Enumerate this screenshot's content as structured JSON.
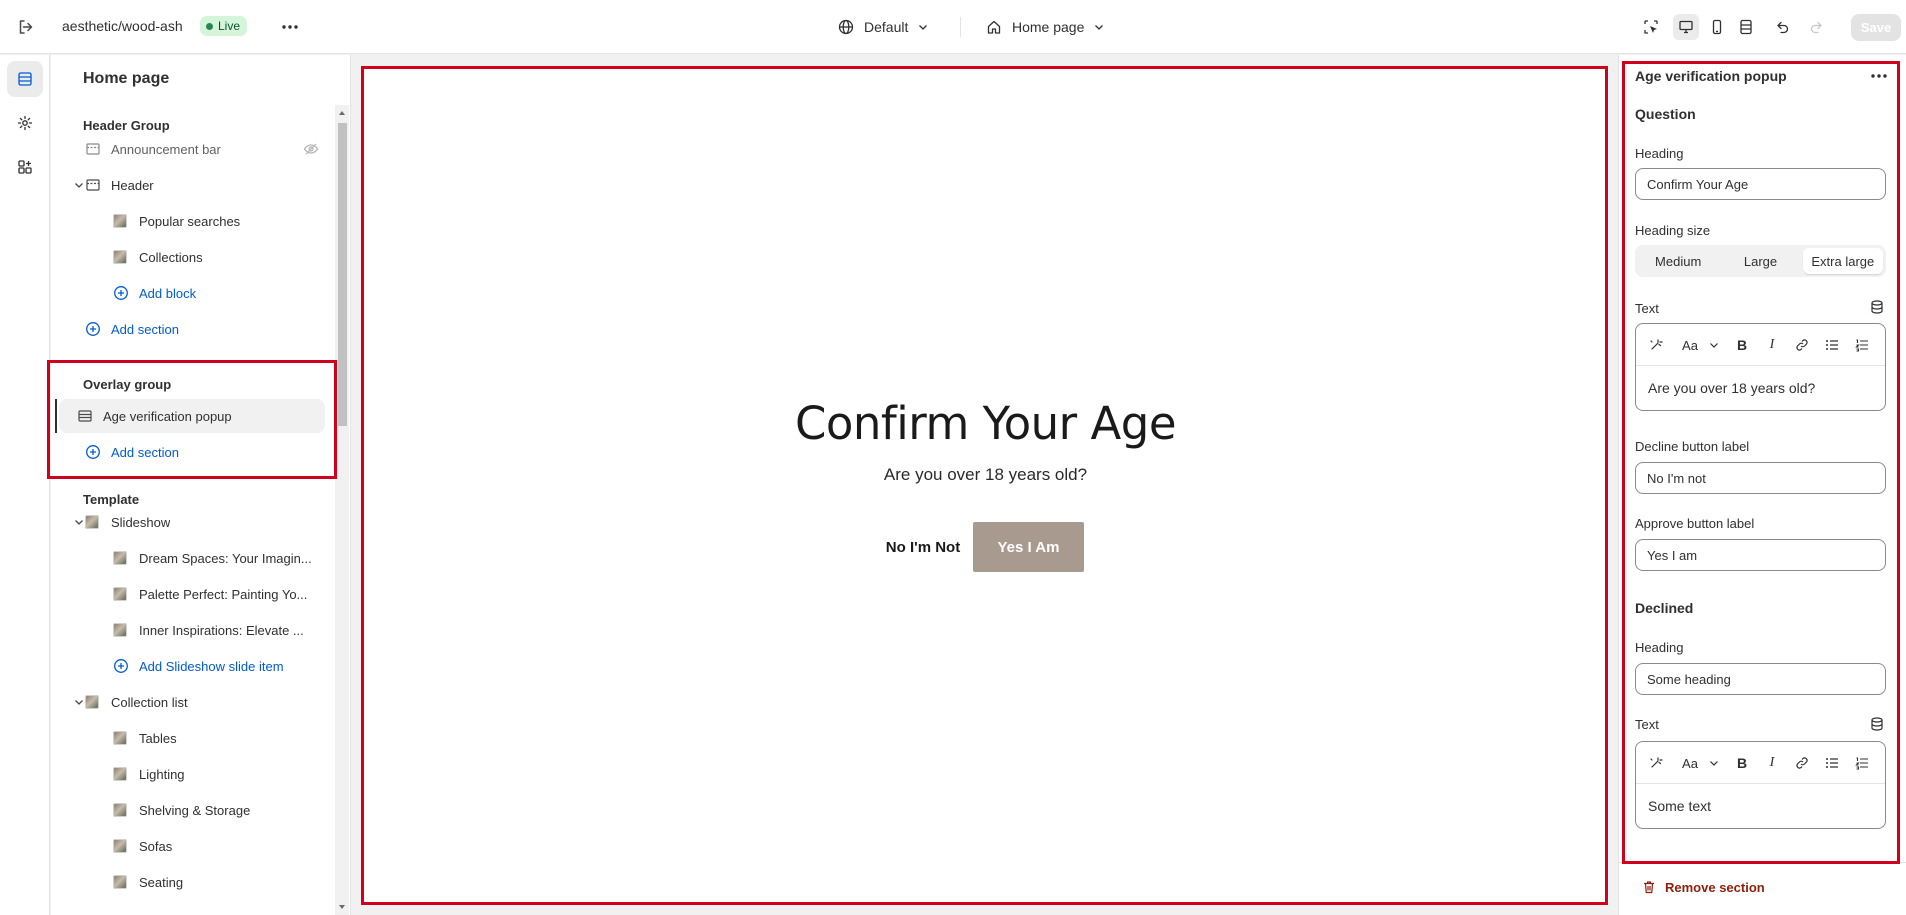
{
  "topbar": {
    "store_name": "aesthetic/wood-ash",
    "status": "Live",
    "theme_selector": "Default",
    "page_selector": "Home page",
    "save_label": "Save"
  },
  "sidebar": {
    "title": "Home page",
    "header_group": {
      "title": "Header Group",
      "announcement_bar": "Announcement bar",
      "header": "Header",
      "popular_searches": "Popular searches",
      "collections": "Collections",
      "add_block": "Add block",
      "add_section": "Add section"
    },
    "overlay_group": {
      "title": "Overlay group",
      "age_verification": "Age verification popup",
      "add_section": "Add section"
    },
    "template": {
      "title": "Template",
      "slideshow": "Slideshow",
      "slides": [
        "Dream Spaces: Your Imagin...",
        "Palette Perfect: Painting Yo...",
        "Inner Inspirations: Elevate ..."
      ],
      "add_slide": "Add Slideshow slide item",
      "collection_list": "Collection list",
      "collections": [
        "Tables",
        "Lighting",
        "Shelving & Storage",
        "Sofas",
        "Seating"
      ]
    }
  },
  "preview": {
    "heading": "Confirm Your Age",
    "text": "Are you over 18 years old?",
    "decline_label": "No I'm Not",
    "approve_label": "Yes I Am"
  },
  "settings": {
    "title": "Age verification popup",
    "question_heading": "Question",
    "heading_label": "Heading",
    "heading_value": "Confirm Your Age",
    "heading_size_label": "Heading size",
    "sizes": [
      "Medium",
      "Large",
      "Extra large"
    ],
    "text_label": "Text",
    "text_value": "Are you over 18 years old?",
    "decline_label": "Decline button label",
    "decline_value": "No I'm not",
    "approve_label": "Approve button label",
    "approve_value": "Yes I am",
    "declined_heading": "Declined",
    "declined_heading_label": "Heading",
    "declined_heading_value": "Some heading",
    "declined_text_label": "Text",
    "declined_text_value": "Some text",
    "remove_label": "Remove section",
    "rte_font_label": "Aa"
  },
  "colors": {
    "accent": "#005bd3",
    "approve_button": "#a99a8f",
    "highlight": "#d0021b",
    "live_badge": "#d4f5d9",
    "danger": "#8e1f0b"
  }
}
